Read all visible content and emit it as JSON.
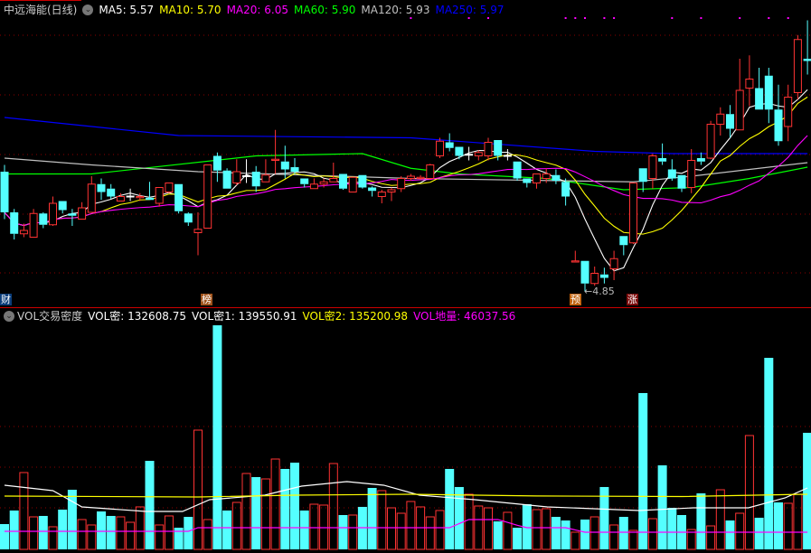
{
  "header": {
    "title": "中远海能(日线)",
    "ma5": "MA5: 5.57",
    "ma10": "MA10: 5.70",
    "ma20": "MA20: 6.05",
    "ma60": "MA60: 5.90",
    "ma120": "MA120: 5.93",
    "ma250": "MA250: 5.97"
  },
  "vol_header": {
    "name": "VOL交易密度",
    "vol_mi": "VOL密: 132608.75",
    "vol_mi1": "VOL密1: 139550.91",
    "vol_mi2": "VOL密2: 135200.98",
    "vol_diliang": "VOL地量: 46037.56"
  },
  "markers": {
    "cai": "财",
    "bang": "榜",
    "yu": "预",
    "zhang": "涨",
    "low_label": "←4.85"
  },
  "colors": {
    "up": "#ff3333",
    "down": "#54ffff",
    "ma5": "#ffffff",
    "ma10": "#ffff00",
    "ma20": "#ff00ff",
    "ma60": "#00ff00",
    "ma120": "#c0c0c0",
    "ma250": "#0000ff",
    "grid": "#8b0000"
  },
  "chart_data": [
    {
      "type": "candlestick",
      "title": "中远海能(日线)",
      "ylim": [
        4.85,
        7.25
      ],
      "ohlc": [
        [
          5.91,
          5.97,
          5.49,
          5.55
        ],
        [
          5.55,
          5.58,
          5.31,
          5.36
        ],
        [
          5.36,
          5.45,
          5.33,
          5.39
        ],
        [
          5.33,
          5.58,
          5.33,
          5.54
        ],
        [
          5.54,
          5.55,
          5.41,
          5.44
        ],
        [
          5.44,
          5.69,
          5.43,
          5.63
        ],
        [
          5.65,
          5.65,
          5.54,
          5.57
        ],
        [
          5.54,
          5.58,
          5.43,
          5.52
        ],
        [
          5.49,
          5.64,
          5.49,
          5.59
        ],
        [
          5.55,
          5.87,
          5.55,
          5.8
        ],
        [
          5.8,
          5.85,
          5.66,
          5.73
        ],
        [
          5.76,
          5.8,
          5.67,
          5.69
        ],
        [
          5.65,
          5.72,
          5.65,
          5.69
        ],
        [
          5.69,
          5.76,
          5.65,
          5.69
        ],
        [
          5.68,
          5.72,
          5.65,
          5.69
        ],
        [
          5.68,
          5.82,
          5.66,
          5.66
        ],
        [
          5.63,
          5.77,
          5.6,
          5.77
        ],
        [
          5.73,
          5.81,
          5.72,
          5.81
        ],
        [
          5.8,
          5.8,
          5.54,
          5.56
        ],
        [
          5.54,
          5.55,
          5.43,
          5.46
        ],
        [
          5.37,
          5.55,
          5.17,
          5.4
        ],
        [
          5.41,
          5.97,
          5.41,
          5.97
        ],
        [
          6.05,
          6.08,
          5.82,
          5.92
        ],
        [
          5.92,
          5.94,
          5.76,
          5.76
        ],
        [
          5.81,
          6.02,
          5.79,
          5.91
        ],
        [
          5.87,
          6.02,
          5.81,
          5.87
        ],
        [
          5.91,
          5.96,
          5.73,
          5.78
        ],
        [
          5.82,
          6.02,
          5.82,
          5.88
        ],
        [
          6.01,
          6.28,
          5.89,
          6.02
        ],
        [
          6.0,
          6.14,
          5.85,
          5.93
        ],
        [
          5.95,
          6.03,
          5.89,
          5.91
        ],
        [
          5.85,
          5.85,
          5.77,
          5.8
        ],
        [
          5.76,
          5.85,
          5.76,
          5.8
        ],
        [
          5.8,
          5.85,
          5.77,
          5.82
        ],
        [
          5.82,
          5.99,
          5.82,
          5.85
        ],
        [
          5.89,
          5.89,
          5.75,
          5.76
        ],
        [
          5.73,
          5.86,
          5.73,
          5.86
        ],
        [
          5.88,
          5.88,
          5.76,
          5.77
        ],
        [
          5.77,
          5.78,
          5.69,
          5.74
        ],
        [
          5.69,
          5.75,
          5.63,
          5.73
        ],
        [
          5.73,
          5.77,
          5.65,
          5.75
        ],
        [
          5.76,
          5.87,
          5.73,
          5.85
        ],
        [
          5.85,
          5.89,
          5.83,
          5.87
        ],
        [
          5.85,
          5.88,
          5.84,
          5.86
        ],
        [
          5.85,
          5.98,
          5.84,
          5.97
        ],
        [
          6.05,
          6.21,
          6.03,
          6.18
        ],
        [
          6.17,
          6.25,
          6.09,
          6.12
        ],
        [
          6.13,
          6.13,
          6.02,
          6.05
        ],
        [
          6.06,
          6.13,
          6.01,
          6.06
        ],
        [
          6.05,
          6.1,
          6.01,
          6.08
        ],
        [
          6.05,
          6.21,
          6.01,
          6.17
        ],
        [
          6.19,
          6.19,
          6.01,
          6.05
        ],
        [
          6.05,
          6.11,
          6.01,
          6.05
        ],
        [
          6.0,
          6.0,
          5.83,
          5.85
        ],
        [
          5.85,
          5.85,
          5.77,
          5.81
        ],
        [
          5.81,
          5.89,
          5.76,
          5.89
        ],
        [
          5.85,
          5.94,
          5.81,
          5.89
        ],
        [
          5.88,
          5.93,
          5.8,
          5.83
        ],
        [
          5.82,
          5.85,
          5.61,
          5.69
        ],
        [
          5.11,
          5.21,
          5.11,
          5.12
        ],
        [
          5.12,
          5.12,
          4.85,
          4.92
        ],
        [
          4.92,
          5.07,
          4.9,
          5.01
        ],
        [
          5.0,
          5.06,
          4.92,
          4.97
        ],
        [
          5.05,
          5.21,
          4.95,
          5.14
        ],
        [
          5.34,
          5.34,
          5.17,
          5.26
        ],
        [
          5.28,
          5.81,
          5.27,
          5.81
        ],
        [
          5.94,
          5.94,
          5.73,
          5.82
        ],
        [
          5.85,
          6.07,
          5.76,
          6.05
        ],
        [
          6.03,
          6.16,
          5.97,
          6.0
        ],
        [
          5.93,
          6.02,
          5.83,
          5.85
        ],
        [
          5.88,
          5.88,
          5.73,
          5.76
        ],
        [
          5.77,
          6.11,
          5.72,
          6.01
        ],
        [
          6.03,
          6.08,
          5.97,
          6.0
        ],
        [
          6.03,
          6.36,
          6.02,
          6.33
        ],
        [
          6.33,
          6.48,
          6.23,
          6.42
        ],
        [
          6.42,
          6.5,
          6.21,
          6.29
        ],
        [
          6.28,
          6.91,
          6.28,
          6.63
        ],
        [
          6.65,
          6.94,
          6.49,
          6.73
        ],
        [
          6.65,
          6.83,
          6.46,
          6.46
        ],
        [
          6.76,
          6.83,
          6.34,
          6.46
        ],
        [
          6.46,
          6.68,
          6.14,
          6.18
        ],
        [
          6.31,
          6.68,
          6.18,
          6.57
        ],
        [
          6.61,
          7.12,
          6.55,
          7.08
        ],
        [
          6.91,
          7.25,
          6.77,
          6.89
        ]
      ],
      "ma_computed": [
        {
          "name": "MA5",
          "period": 5
        },
        {
          "name": "MA10",
          "period": 10
        },
        {
          "name": "MA20",
          "period": 20
        }
      ],
      "ma_series": [
        {
          "name": "MA60",
          "points": [
            [
              0,
              5.89
            ],
            [
              9,
              5.89
            ],
            [
              26,
              6.05
            ],
            [
              37,
              6.07
            ],
            [
              42,
              5.94
            ],
            [
              47,
              5.89
            ],
            [
              56,
              5.85
            ],
            [
              64,
              5.75
            ],
            [
              71,
              5.77
            ],
            [
              77,
              5.85
            ],
            [
              83,
              5.95
            ]
          ]
        },
        {
          "name": "MA120",
          "points": [
            [
              0,
              6.03
            ],
            [
              9,
              5.97
            ],
            [
              20,
              5.91
            ],
            [
              42,
              5.85
            ],
            [
              65,
              5.82
            ],
            [
              71,
              5.87
            ],
            [
              83,
              5.99
            ]
          ]
        },
        {
          "name": "MA250",
          "points": [
            [
              0,
              6.39
            ],
            [
              18,
              6.23
            ],
            [
              42,
              6.21
            ],
            [
              61,
              6.09
            ],
            [
              69,
              6.07
            ],
            [
              83,
              6.07
            ]
          ]
        }
      ],
      "signal_dots": [
        42,
        48,
        50,
        58,
        59,
        60,
        62,
        63,
        69,
        72,
        76,
        79,
        81
      ],
      "low_point": {
        "index": 60,
        "value": 4.85
      }
    },
    {
      "type": "bar",
      "title": "VOL交易密度",
      "volume": [
        63000,
        96800,
        191300,
        81000,
        83300,
        56300,
        99000,
        148500,
        74300,
        60800,
        94500,
        83300,
        81000,
        67500,
        105800,
        220500,
        60800,
        83300,
        54000,
        81000,
        297000,
        74300,
        558000,
        96800,
        117000,
        189000,
        180000,
        175500,
        225000,
        200300,
        216000,
        96800,
        112500,
        110300,
        213800,
        85500,
        85500,
        105800,
        153000,
        146300,
        103500,
        90000,
        119300,
        105800,
        81000,
        96800,
        200300,
        155300,
        137300,
        108000,
        103500,
        69800,
        92300,
        54000,
        112500,
        99000,
        101300,
        81000,
        72000,
        42800,
        74300,
        81000,
        155300,
        60800,
        81000,
        47300,
        389300,
        76500,
        209300,
        103500,
        85500,
        49500,
        139500,
        58500,
        148500,
        72000,
        90000,
        283500,
        78800,
        477000,
        117000,
        114800,
        137300,
        290300
      ],
      "lines": [
        {
          "name": "VOL密",
          "points": [
            [
              0,
              159800
            ],
            [
              5,
              146300
            ],
            [
              8,
              105800
            ],
            [
              14.6,
              94500
            ],
            [
              18.4,
              94500
            ],
            [
              21.2,
              123800
            ],
            [
              26.9,
              135000
            ],
            [
              30.7,
              157500
            ],
            [
              35.4,
              168800
            ],
            [
              39.2,
              159800
            ],
            [
              42.9,
              135000
            ],
            [
              48.6,
              123800
            ],
            [
              56.1,
              105800
            ],
            [
              65.6,
              96800
            ],
            [
              71.2,
              103500
            ],
            [
              76.9,
              103500
            ],
            [
              80.7,
              128300
            ],
            [
              83,
              153000
            ]
          ]
        },
        {
          "name": "VOL密2",
          "points": [
            [
              0,
              132800
            ],
            [
              20,
              130500
            ],
            [
              30,
              135000
            ],
            [
              42,
              137300
            ],
            [
              55,
              133000
            ],
            [
              70,
              131600
            ],
            [
              83,
              137300
            ]
          ]
        },
        {
          "name": "VOL地量",
          "points": [
            [
              0,
              45000
            ],
            [
              19,
              45000
            ],
            [
              20,
              54000
            ],
            [
              46,
              54000
            ],
            [
              48,
              74300
            ],
            [
              51,
              74300
            ],
            [
              53,
              60000
            ],
            [
              54,
              54000
            ],
            [
              58,
              54000
            ],
            [
              60,
              42800
            ],
            [
              83,
              42800
            ]
          ]
        }
      ]
    }
  ]
}
